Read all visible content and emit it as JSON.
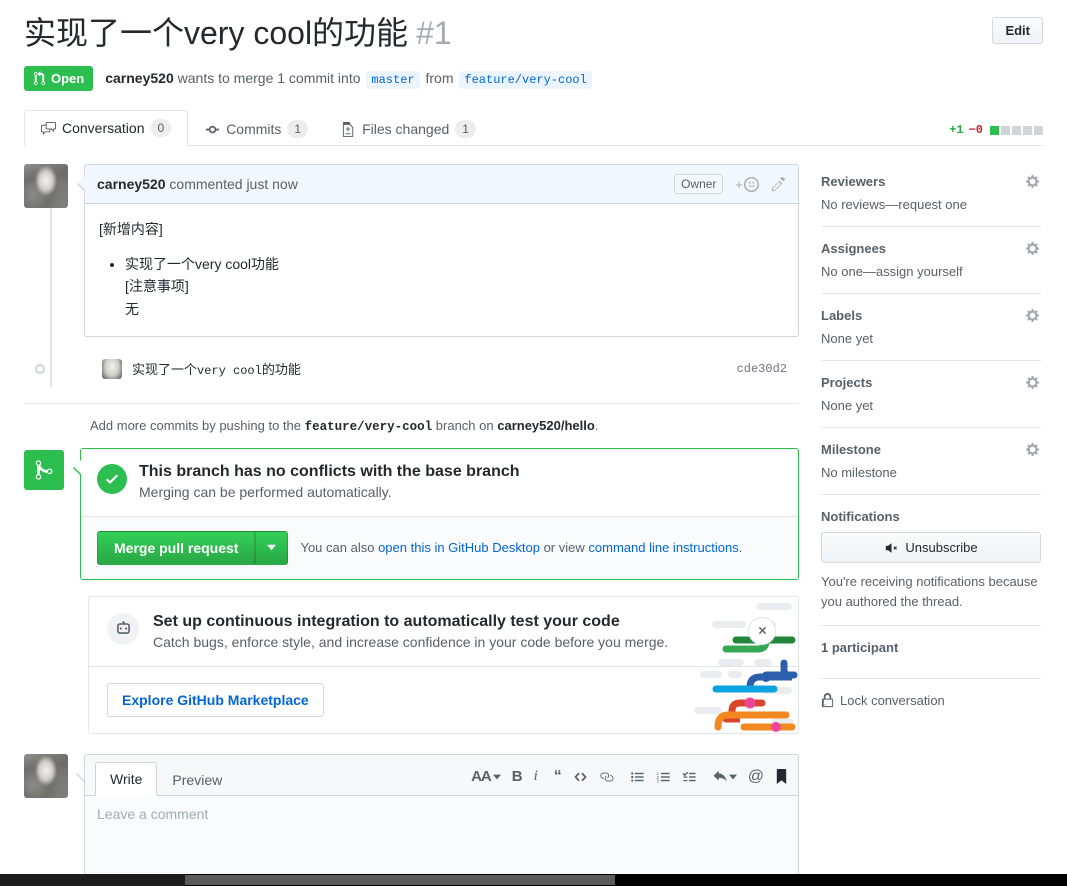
{
  "header": {
    "title": "实现了一个very cool的功能",
    "number": "#1",
    "edit_label": "Edit",
    "state": "Open",
    "author": "carney520",
    "meta_1": "wants to merge 1 commit into",
    "base_branch": "master",
    "meta_2": "from",
    "head_branch": "feature/very-cool"
  },
  "tabs": [
    {
      "label": "Conversation",
      "count": "0",
      "icon": "comment-discussion-icon",
      "active": true
    },
    {
      "label": "Commits",
      "count": "1",
      "icon": "git-commit-icon",
      "active": false
    },
    {
      "label": "Files changed",
      "count": "1",
      "icon": "diff-icon",
      "active": false
    }
  ],
  "diffstat": {
    "additions": "+1",
    "deletions": "−0",
    "green_blocks": 1,
    "gray_blocks": 4
  },
  "comment": {
    "author": "carney520",
    "action": "commented just now",
    "owner_badge": "Owner",
    "body_intro": "[新增内容]",
    "bullets": [
      "实现了一个very cool功能"
    ],
    "body_note_title": "[注意事项]",
    "body_note": "无"
  },
  "commit": {
    "message_cn": "实现了一个",
    "message_mono": "very cool",
    "message_cn2": "的功能",
    "sha": "cde30d2"
  },
  "push_line": {
    "prefix": "Add more commits by pushing to the",
    "branch": "feature/very-cool",
    "middle": "branch on",
    "repo": "carney520/hello",
    "suffix": "."
  },
  "merge": {
    "headline": "This branch has no conflicts with the base branch",
    "sub": "Merging can be performed automatically.",
    "button": "Merge pull request",
    "hint_prefix": "You can also",
    "hint_link_1": "open this in GitHub Desktop",
    "hint_middle": "or view",
    "hint_link_2": "command line instructions",
    "hint_suffix": "."
  },
  "promo": {
    "headline": "Set up continuous integration to automatically test your code",
    "sub": "Catch bugs, enforce style, and increase confidence in your code before you merge.",
    "button": "Explore GitHub Marketplace"
  },
  "new_comment": {
    "tab_write": "Write",
    "tab_preview": "Preview",
    "placeholder": "Leave a comment",
    "tools": [
      "text-size-icon",
      "bold-icon",
      "italic-icon",
      "quote-icon",
      "code-icon",
      "link-icon",
      "unordered-list-icon",
      "ordered-list-icon",
      "task-list-icon",
      "reply-icon",
      "mention-icon",
      "saved-reply-icon"
    ]
  },
  "sidebar": {
    "sections": [
      {
        "title": "Reviewers",
        "value": "No reviews—request one",
        "gear": true
      },
      {
        "title": "Assignees",
        "value": "No one—assign yourself",
        "gear": true
      },
      {
        "title": "Labels",
        "value": "None yet",
        "gear": true
      },
      {
        "title": "Projects",
        "value": "None yet",
        "gear": true
      },
      {
        "title": "Milestone",
        "value": "No milestone",
        "gear": true
      }
    ],
    "notifications": {
      "title": "Notifications",
      "button": "Unsubscribe",
      "note": "You're receiving notifications because you authored the thread."
    },
    "participants": {
      "title": "1 participant",
      "count": 1
    },
    "lock": "Lock conversation"
  },
  "colors": {
    "green": "#2cbe4e",
    "blue": "#0366d6",
    "add": "#28a745",
    "del": "#cb2431",
    "border": "#e1e4e8"
  }
}
